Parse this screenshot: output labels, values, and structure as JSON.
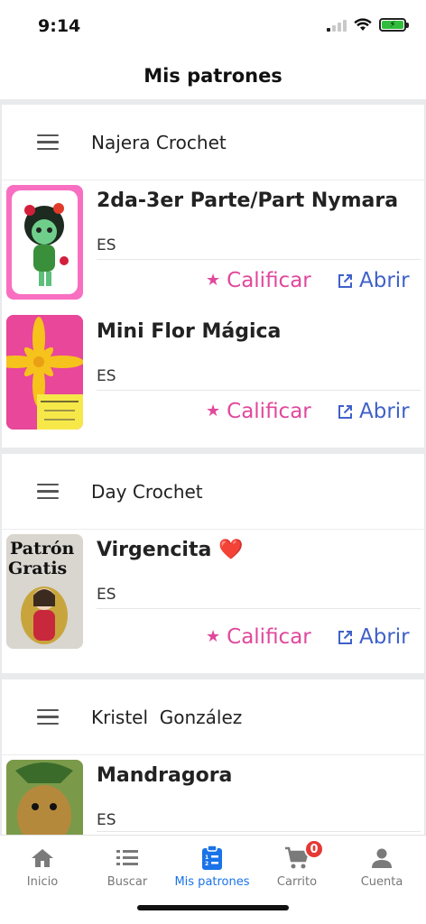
{
  "status": {
    "time": "9:14",
    "battery_color": "#2fbd3b"
  },
  "header": {
    "title": "Mis patrones"
  },
  "groups": [
    {
      "name": "Najera Crochet",
      "items": [
        {
          "title": "2da-3er Parte/Part Nymara",
          "lang": "ES",
          "rate_label": "Calificar",
          "open_label": "Abrir",
          "thumb_color": "#f86fc1"
        },
        {
          "title": "Mini Flor Mágica",
          "lang": "ES",
          "rate_label": "Calificar",
          "open_label": "Abrir",
          "thumb_color": "#e8479a"
        }
      ]
    },
    {
      "name": "Day Crochet",
      "items": [
        {
          "title": "Virgencita ❤️",
          "lang": "ES",
          "rate_label": "Calificar",
          "open_label": "Abrir",
          "thumb_color": "#d9d5cf"
        }
      ]
    },
    {
      "name": "Kristel  González",
      "items": [
        {
          "title": "Mandragora",
          "lang": "ES",
          "thumb_color": "#6b8a3a"
        }
      ]
    }
  ],
  "tabs": [
    {
      "label": "Inicio",
      "icon": "home-icon"
    },
    {
      "label": "Buscar",
      "icon": "list-search-icon"
    },
    {
      "label": "Mis patrones",
      "icon": "clipboard-list-icon",
      "active": true
    },
    {
      "label": "Carrito",
      "icon": "cart-icon",
      "badge": "0"
    },
    {
      "label": "Cuenta",
      "icon": "account-icon"
    }
  ],
  "colors": {
    "rate": "#e0489c",
    "open": "#3f61c9",
    "active_tab": "#1a73e8",
    "badge": "#e53935"
  }
}
